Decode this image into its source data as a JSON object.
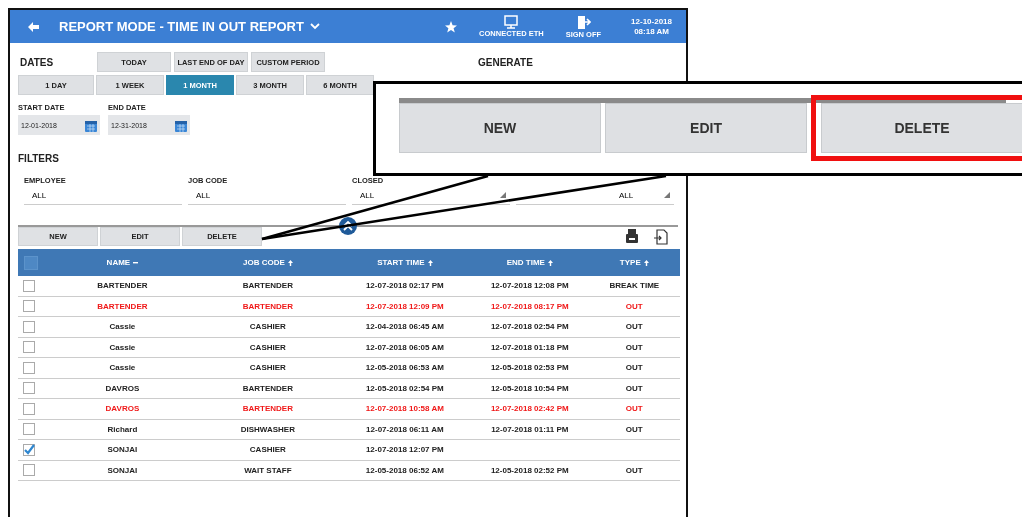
{
  "header": {
    "title": "REPORT MODE - TIME IN OUT REPORT",
    "status": [
      {
        "kind": "network",
        "label": "CONNECTED ETH"
      },
      {
        "kind": "sign_off",
        "label": "SIGN OFF"
      }
    ],
    "date": "12-10-2018",
    "time": "08:18 AM"
  },
  "dates": {
    "title": "DATES",
    "presets": [
      {
        "label": "TODAY",
        "selected": false
      },
      {
        "label": "LAST END OF DAY",
        "selected": false
      },
      {
        "label": "CUSTOM PERIOD",
        "selected": false
      }
    ],
    "ranges": [
      {
        "label": "1 DAY",
        "selected": false
      },
      {
        "label": "1 WEEK",
        "selected": false
      },
      {
        "label": "1 MONTH",
        "selected": true
      },
      {
        "label": "3 MONTH",
        "selected": false
      },
      {
        "label": "6 MONTH",
        "selected": false
      }
    ],
    "start": {
      "label": "START DATE",
      "value": "12-01-2018"
    },
    "end": {
      "label": "END DATE",
      "value": "12-31-2018"
    }
  },
  "generate": {
    "title": "GENERATE"
  },
  "filters": {
    "title": "FILTERS",
    "fields": [
      {
        "label": "EMPLOYEE",
        "value": "ALL",
        "dropdown": false
      },
      {
        "label": "JOB CODE",
        "value": "ALL",
        "dropdown": false
      },
      {
        "label": "CLOSED",
        "value": "ALL",
        "dropdown": true
      },
      {
        "value": "ALL",
        "dropdown": true
      }
    ]
  },
  "toolbar": {
    "buttons": [
      "NEW",
      "EDIT",
      "DELETE"
    ]
  },
  "table": {
    "select_all": false,
    "columns": [
      {
        "label": "NAME",
        "sorted": true
      },
      {
        "label": "JOB CODE",
        "sorted": false
      },
      {
        "label": "START TIME",
        "sorted": false
      },
      {
        "label": "END TIME",
        "sorted": false
      },
      {
        "label": "TYPE",
        "sorted": false
      }
    ],
    "rows": [
      {
        "checked": false,
        "highlighted": false,
        "name": "BARTENDER",
        "job_code": "BARTENDER",
        "start": "12-07-2018 02:17 PM",
        "end": "12-07-2018 12:08 PM",
        "type": "BREAK TIME"
      },
      {
        "checked": false,
        "highlighted": true,
        "name": "BARTENDER",
        "job_code": "BARTENDER",
        "start": "12-07-2018 12:09 PM",
        "end": "12-07-2018 08:17 PM",
        "type": "OUT"
      },
      {
        "checked": false,
        "highlighted": false,
        "name": "Cassie",
        "job_code": "CASHIER",
        "start": "12-04-2018 06:45 AM",
        "end": "12-07-2018 02:54 PM",
        "type": "OUT"
      },
      {
        "checked": false,
        "highlighted": false,
        "name": "Cassie",
        "job_code": "CASHIER",
        "start": "12-07-2018 06:05 AM",
        "end": "12-07-2018 01:18 PM",
        "type": "OUT"
      },
      {
        "checked": false,
        "highlighted": false,
        "name": "Cassie",
        "job_code": "CASHIER",
        "start": "12-05-2018 06:53 AM",
        "end": "12-05-2018 02:53 PM",
        "type": "OUT"
      },
      {
        "checked": false,
        "highlighted": false,
        "name": "DAVROS",
        "job_code": "BARTENDER",
        "start": "12-05-2018 02:54 PM",
        "end": "12-05-2018 10:54 PM",
        "type": "OUT"
      },
      {
        "checked": false,
        "highlighted": true,
        "name": "DAVROS",
        "job_code": "BARTENDER",
        "start": "12-07-2018 10:58 AM",
        "end": "12-07-2018 02:42 PM",
        "type": "OUT"
      },
      {
        "checked": false,
        "highlighted": false,
        "name": "Richard",
        "job_code": "DISHWASHER",
        "start": "12-07-2018 06:11 AM",
        "end": "12-07-2018 01:11 PM",
        "type": "OUT"
      },
      {
        "checked": true,
        "highlighted": false,
        "name": "SONJAI",
        "job_code": "CASHIER",
        "start": "12-07-2018 12:07 PM"
      },
      {
        "checked": false,
        "highlighted": false,
        "name": "SONJAI",
        "job_code": "WAIT STAFF",
        "start": "12-05-2018 06:52 AM",
        "end": "12-05-2018 02:52 PM",
        "type": "OUT"
      }
    ]
  },
  "callout": {
    "buttons": [
      {
        "label": "NEW",
        "highlighted": false
      },
      {
        "label": "EDIT",
        "highlighted": false
      },
      {
        "label": "DELETE",
        "highlighted": true
      }
    ]
  }
}
